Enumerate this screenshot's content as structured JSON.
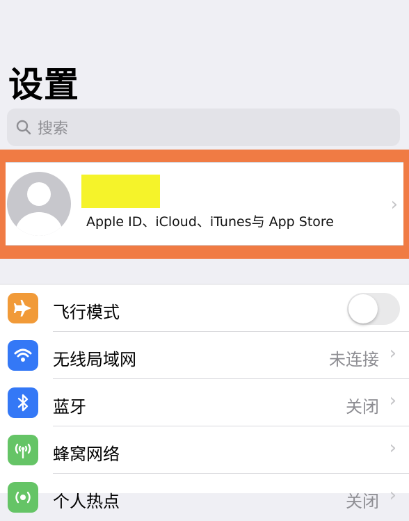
{
  "header": {
    "title": "设置"
  },
  "search": {
    "placeholder": "搜索",
    "icon": "search-icon"
  },
  "profile": {
    "subtitle": "Apple ID、iCloud、iTunes与 App Store",
    "highlight_color": "#f07b44",
    "redaction_color": "#f5f32a"
  },
  "settings": {
    "items": [
      {
        "label": "飞行模式",
        "icon": "airplane-icon",
        "icon_color": "#f19a38",
        "toggle": "off"
      },
      {
        "label": "无线局域网",
        "value": "未连接",
        "icon": "wifi-icon",
        "icon_color": "#3478f6"
      },
      {
        "label": "蓝牙",
        "value": "关闭",
        "icon": "bluetooth-icon",
        "icon_color": "#3478f6"
      },
      {
        "label": "蜂窝网络",
        "icon": "cellular-icon",
        "icon_color": "#65c466"
      },
      {
        "label": "个人热点",
        "value": "关闭",
        "icon": "hotspot-icon",
        "icon_color": "#65c466"
      }
    ]
  }
}
